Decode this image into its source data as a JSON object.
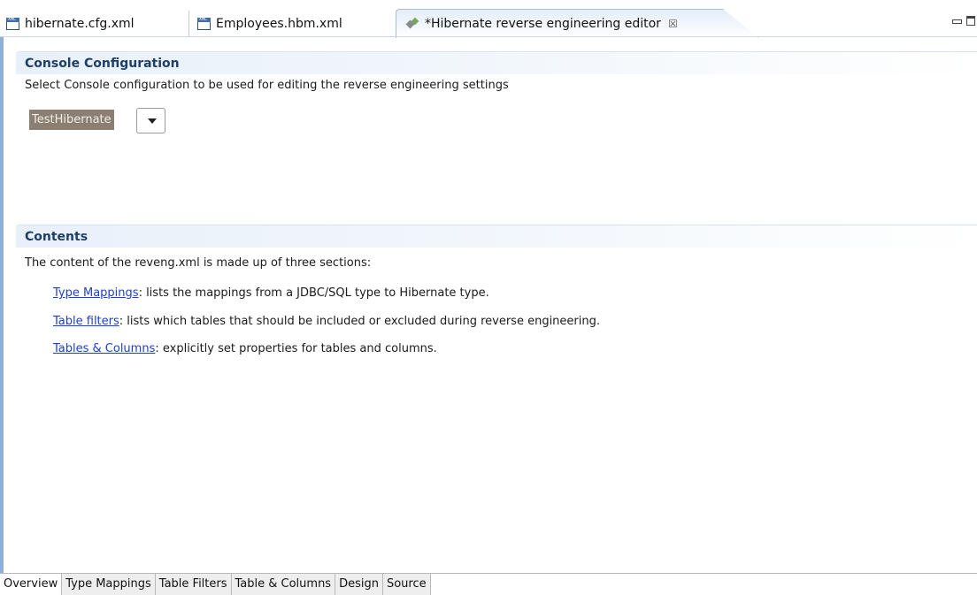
{
  "editor_tabs": [
    {
      "label": "hibernate.cfg.xml"
    },
    {
      "label": "Employees.hbm.xml"
    },
    {
      "label": "*Hibernate reverse engineering editor",
      "close": "☒"
    }
  ],
  "console_section": {
    "title": "Console Configuration",
    "description": "Select Console configuration to be used for editing the reverse engineering settings",
    "selected_value": "TestHibernate"
  },
  "contents_section": {
    "title": "Contents",
    "description": "The content of the reveng.xml is made up of three sections:",
    "items": [
      {
        "link": "Type Mappings",
        "text": ": lists the mappings from a JDBC/SQL type to Hibernate type."
      },
      {
        "link": "Table filters",
        "text": ": lists which tables that should be included or excluded during reverse engineering."
      },
      {
        "link": "Tables & Columns",
        "text": ": explicitly set properties for tables and columns."
      }
    ]
  },
  "page_tabs": [
    {
      "label": "Overview"
    },
    {
      "label": "Type Mappings"
    },
    {
      "label": "Table Filters"
    },
    {
      "label": "Table & Columns"
    },
    {
      "label": "Design"
    },
    {
      "label": "Source"
    }
  ],
  "icons": {
    "xml_file": "xml-file-icon",
    "hibernate": "hibernate-icon",
    "minimize": "minimize-icon",
    "maximize": "maximize-icon",
    "dropdown": "chevron-down-icon"
  },
  "colors": {
    "section_title": "#1e3f66",
    "link": "#1d3ed1",
    "selection_bg": "#8a7f72"
  }
}
